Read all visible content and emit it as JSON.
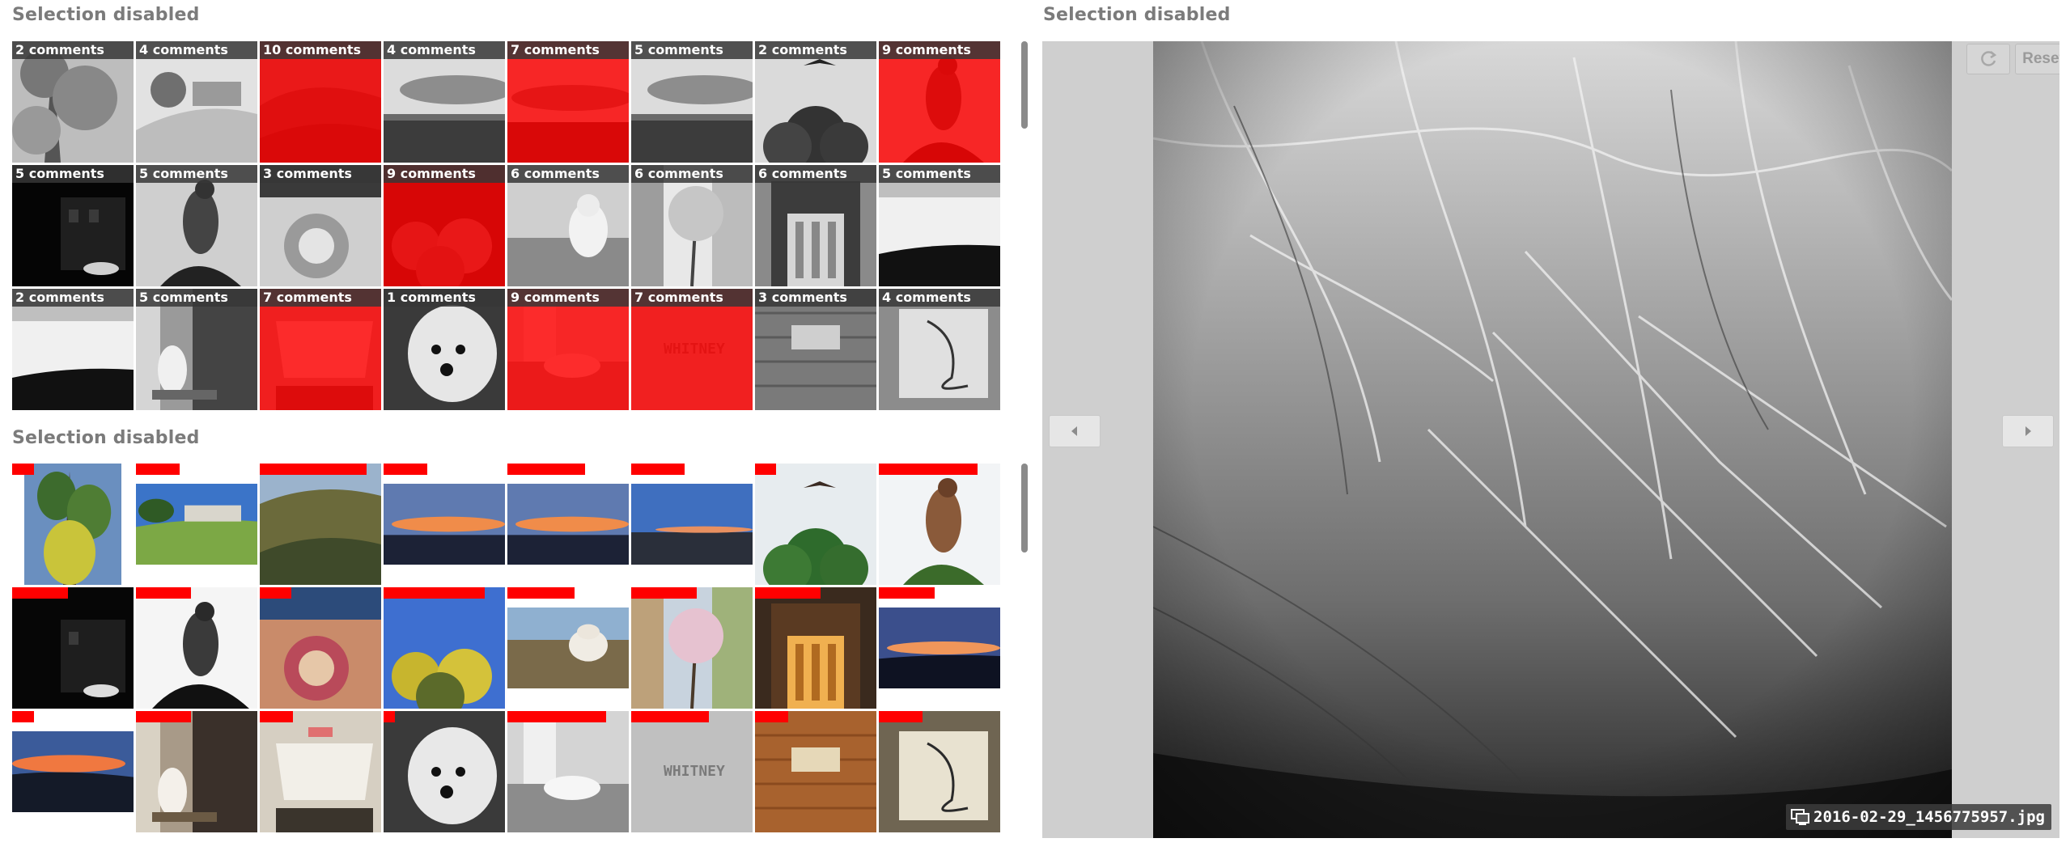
{
  "top_panel": {
    "title": "Selection disabled",
    "tiles": [
      {
        "label": "2 comments",
        "tone": "gray",
        "scene": "tree"
      },
      {
        "label": "4 comments",
        "tone": "gray",
        "scene": "hill"
      },
      {
        "label": "10 comments",
        "tone": "red",
        "scene": "brush"
      },
      {
        "label": "4 comments",
        "tone": "gray",
        "scene": "sky"
      },
      {
        "label": "7 comments",
        "tone": "red",
        "scene": "sunset"
      },
      {
        "label": "5 comments",
        "tone": "gray",
        "scene": "sky"
      },
      {
        "label": "2 comments",
        "tone": "gray",
        "scene": "bird-tree"
      },
      {
        "label": "9 comments",
        "tone": "red",
        "scene": "hawk"
      },
      {
        "label": "5 comments",
        "tone": "gray",
        "scene": "house"
      },
      {
        "label": "5 comments",
        "tone": "gray",
        "scene": "hawk"
      },
      {
        "label": "3 comments",
        "tone": "gray",
        "scene": "mural"
      },
      {
        "label": "9 comments",
        "tone": "red",
        "scene": "flowers"
      },
      {
        "label": "6 comments",
        "tone": "gray",
        "scene": "dog"
      },
      {
        "label": "6 comments",
        "tone": "gray",
        "scene": "blossom"
      },
      {
        "label": "6 comments",
        "tone": "gray",
        "scene": "building"
      },
      {
        "label": "5 comments",
        "tone": "gray",
        "scene": "dusk"
      },
      {
        "label": "2 comments",
        "tone": "gray",
        "scene": "dusk"
      },
      {
        "label": "5 comments",
        "tone": "gray",
        "scene": "door-dog"
      },
      {
        "label": "7 comments",
        "tone": "red",
        "scene": "box"
      },
      {
        "label": "1 comments",
        "tone": "gray",
        "scene": "dog-face"
      },
      {
        "label": "9 comments",
        "tone": "red",
        "scene": "dog-floor"
      },
      {
        "label": "7 comments",
        "tone": "red",
        "scene": "whitney"
      },
      {
        "label": "3 comments",
        "tone": "gray",
        "scene": "plaque"
      },
      {
        "label": "4 comments",
        "tone": "gray",
        "scene": "paper"
      }
    ]
  },
  "bottom_panel": {
    "title": "Selection disabled",
    "tiles": [
      {
        "bar": 0.18,
        "scene": "tree-color",
        "fit": "portrait"
      },
      {
        "bar": 0.36,
        "scene": "hill-color",
        "fit": "land"
      },
      {
        "bar": 0.88,
        "scene": "brush-color",
        "fit": "full"
      },
      {
        "bar": 0.36,
        "scene": "sunset-color",
        "fit": "land"
      },
      {
        "bar": 0.64,
        "scene": "sunset-color",
        "fit": "land"
      },
      {
        "bar": 0.44,
        "scene": "bluesky",
        "fit": "land"
      },
      {
        "bar": 0.17,
        "scene": "bird-color",
        "fit": "full"
      },
      {
        "bar": 0.81,
        "scene": "hawk-color",
        "fit": "full"
      },
      {
        "bar": 0.46,
        "scene": "house-dark",
        "fit": "full"
      },
      {
        "bar": 0.45,
        "scene": "hawk-bw",
        "fit": "full"
      },
      {
        "bar": 0.26,
        "scene": "mural-color",
        "fit": "full"
      },
      {
        "bar": 0.83,
        "scene": "flowers-color",
        "fit": "full"
      },
      {
        "bar": 0.55,
        "scene": "dog-color",
        "fit": "land"
      },
      {
        "bar": 0.54,
        "scene": "blossom-color",
        "fit": "full"
      },
      {
        "bar": 0.54,
        "scene": "building-color",
        "fit": "full"
      },
      {
        "bar": 0.46,
        "scene": "dusk-color",
        "fit": "land"
      },
      {
        "bar": 0.18,
        "scene": "sunset2-color",
        "fit": "land"
      },
      {
        "bar": 0.45,
        "scene": "door-dog-color",
        "fit": "full"
      },
      {
        "bar": 0.27,
        "scene": "box-color",
        "fit": "full"
      },
      {
        "bar": 0.09,
        "scene": "dog-face-bw",
        "fit": "full"
      },
      {
        "bar": 0.81,
        "scene": "dog-floor-bw",
        "fit": "full"
      },
      {
        "bar": 0.64,
        "scene": "whitney-bw",
        "fit": "full"
      },
      {
        "bar": 0.27,
        "scene": "plaque-color",
        "fit": "full"
      },
      {
        "bar": 0.36,
        "scene": "paper-color",
        "fit": "full"
      }
    ]
  },
  "viewer": {
    "title": "Selection disabled",
    "caption": "2016-02-29_1456775957.jpg",
    "reset_label": "Reset",
    "icons": {
      "prev": "chevron-left-icon",
      "next": "chevron-right-icon",
      "refresh": "refresh-icon",
      "caption": "monitor-icon"
    }
  },
  "colors": {
    "selection_red": "#ff0000",
    "title_gray": "#7b7b7b",
    "viewer_bg": "#cfcfcf"
  }
}
